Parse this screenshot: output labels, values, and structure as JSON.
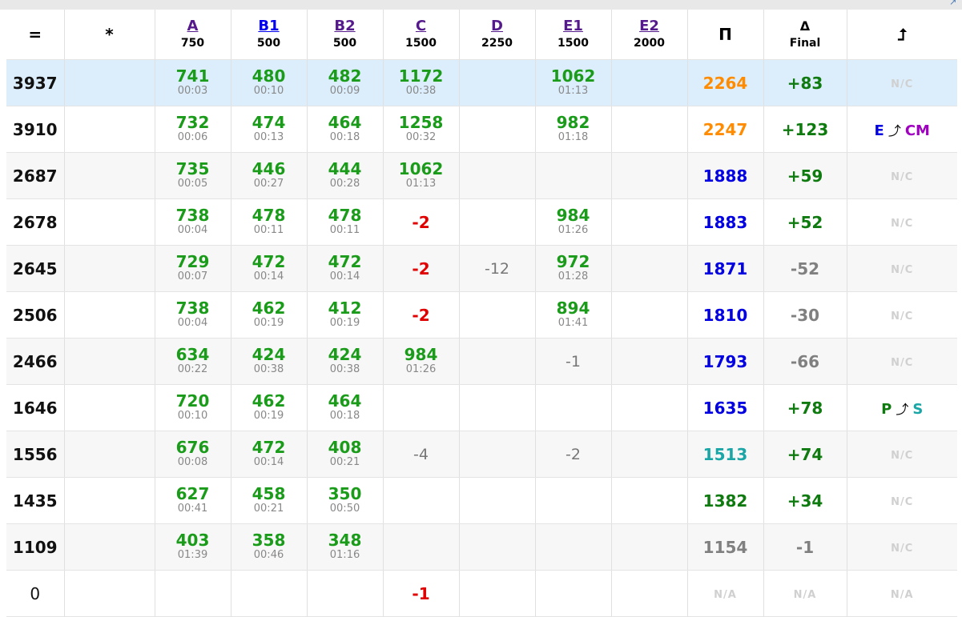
{
  "colors": {
    "green": "#1a9b1a",
    "dark_green": "#0f7a0f",
    "red": "#e00000",
    "orange": "#ff8c00",
    "blue": "#0000e0",
    "teal": "#1aa6a6",
    "gray": "#808080",
    "light_gray": "#d0d0d0",
    "purple": "#a000c0",
    "highlight": "#dceefc"
  },
  "header": {
    "rating": "=",
    "name": "*",
    "problems": [
      {
        "label": "A",
        "points": "750"
      },
      {
        "label": "B1",
        "points": "500"
      },
      {
        "label": "B2",
        "points": "500"
      },
      {
        "label": "C",
        "points": "1500"
      },
      {
        "label": "D",
        "points": "2250"
      },
      {
        "label": "E1",
        "points": "1500"
      },
      {
        "label": "E2",
        "points": "2000"
      }
    ],
    "total": "Π",
    "delta_symbol": "Δ",
    "delta_sub": "Final",
    "rank_change": "⮥"
  },
  "rows": [
    {
      "rating": "3937",
      "highlight": true,
      "cells": [
        {
          "score": "741",
          "time": "00:03"
        },
        {
          "score": "480",
          "time": "00:10"
        },
        {
          "score": "482",
          "time": "00:09"
        },
        {
          "score": "1172",
          "time": "00:38"
        },
        null,
        {
          "score": "1062",
          "time": "01:13"
        },
        null
      ],
      "total": "2264",
      "total_color": "#ff8c00",
      "delta": "+83",
      "delta_color": "#0f7a0f",
      "rank": "N/C"
    },
    {
      "rating": "3910",
      "cells": [
        {
          "score": "732",
          "time": "00:06"
        },
        {
          "score": "474",
          "time": "00:13"
        },
        {
          "score": "464",
          "time": "00:18"
        },
        {
          "score": "1258",
          "time": "00:32"
        },
        null,
        {
          "score": "982",
          "time": "01:18"
        },
        null
      ],
      "total": "2247",
      "total_color": "#ff8c00",
      "delta": "+123",
      "delta_color": "#0f7a0f",
      "rank_from": "E",
      "rank_from_color": "#0000e0",
      "rank_to": "CM",
      "rank_to_color": "#a000c0"
    },
    {
      "rating": "2687",
      "cells": [
        {
          "score": "735",
          "time": "00:05"
        },
        {
          "score": "446",
          "time": "00:27"
        },
        {
          "score": "444",
          "time": "00:28"
        },
        {
          "score": "1062",
          "time": "01:13"
        },
        null,
        null,
        null
      ],
      "total": "1888",
      "total_color": "#0000e0",
      "delta": "+59",
      "delta_color": "#0f7a0f",
      "rank": "N/C"
    },
    {
      "rating": "2678",
      "cells": [
        {
          "score": "738",
          "time": "00:04"
        },
        {
          "score": "478",
          "time": "00:11"
        },
        {
          "score": "478",
          "time": "00:11"
        },
        {
          "fail": "-2"
        },
        null,
        {
          "score": "984",
          "time": "01:26"
        },
        null
      ],
      "total": "1883",
      "total_color": "#0000e0",
      "delta": "+52",
      "delta_color": "#0f7a0f",
      "rank": "N/C"
    },
    {
      "rating": "2645",
      "cells": [
        {
          "score": "729",
          "time": "00:07"
        },
        {
          "score": "472",
          "time": "00:14"
        },
        {
          "score": "472",
          "time": "00:14"
        },
        {
          "fail": "-2"
        },
        {
          "pending": "-12"
        },
        {
          "score": "972",
          "time": "01:28"
        },
        null
      ],
      "total": "1871",
      "total_color": "#0000e0",
      "delta": "-52",
      "delta_color": "#808080",
      "rank": "N/C"
    },
    {
      "rating": "2506",
      "cells": [
        {
          "score": "738",
          "time": "00:04"
        },
        {
          "score": "462",
          "time": "00:19"
        },
        {
          "score": "412",
          "time": "00:19"
        },
        {
          "fail": "-2"
        },
        null,
        {
          "score": "894",
          "time": "01:41"
        },
        null
      ],
      "total": "1810",
      "total_color": "#0000e0",
      "delta": "-30",
      "delta_color": "#808080",
      "rank": "N/C"
    },
    {
      "rating": "2466",
      "cells": [
        {
          "score": "634",
          "time": "00:22"
        },
        {
          "score": "424",
          "time": "00:38"
        },
        {
          "score": "424",
          "time": "00:38"
        },
        {
          "score": "984",
          "time": "01:26"
        },
        null,
        {
          "pending": "-1"
        },
        null
      ],
      "total": "1793",
      "total_color": "#0000e0",
      "delta": "-66",
      "delta_color": "#808080",
      "rank": "N/C"
    },
    {
      "rating": "1646",
      "cells": [
        {
          "score": "720",
          "time": "00:10"
        },
        {
          "score": "462",
          "time": "00:19"
        },
        {
          "score": "464",
          "time": "00:18"
        },
        null,
        null,
        null,
        null
      ],
      "total": "1635",
      "total_color": "#0000e0",
      "delta": "+78",
      "delta_color": "#0f7a0f",
      "rank_from": "P",
      "rank_from_color": "#0f7a0f",
      "rank_to": "S",
      "rank_to_color": "#1aa6a6"
    },
    {
      "rating": "1556",
      "cells": [
        {
          "score": "676",
          "time": "00:08"
        },
        {
          "score": "472",
          "time": "00:14"
        },
        {
          "score": "408",
          "time": "00:21"
        },
        {
          "pending": "-4"
        },
        null,
        {
          "pending": "-2"
        },
        null
      ],
      "total": "1513",
      "total_color": "#1aa6a6",
      "delta": "+74",
      "delta_color": "#0f7a0f",
      "rank": "N/C"
    },
    {
      "rating": "1435",
      "cells": [
        {
          "score": "627",
          "time": "00:41"
        },
        {
          "score": "458",
          "time": "00:21"
        },
        {
          "score": "350",
          "time": "00:50"
        },
        null,
        null,
        null,
        null
      ],
      "total": "1382",
      "total_color": "#0f7a0f",
      "delta": "+34",
      "delta_color": "#0f7a0f",
      "rank": "N/C"
    },
    {
      "rating": "1109",
      "cells": [
        {
          "score": "403",
          "time": "01:39"
        },
        {
          "score": "358",
          "time": "00:46"
        },
        {
          "score": "348",
          "time": "01:16"
        },
        null,
        null,
        null,
        null
      ],
      "total": "1154",
      "total_color": "#808080",
      "delta": "-1",
      "delta_color": "#808080",
      "rank": "N/C"
    },
    {
      "rating": "0",
      "plain": true,
      "cells": [
        null,
        null,
        null,
        {
          "fail": "-1"
        },
        null,
        null,
        null
      ],
      "total": "N/A",
      "total_color": "#d0d0d0",
      "delta": "N/A",
      "delta_color": "#d0d0d0",
      "rank": "N/A",
      "na": true
    }
  ]
}
